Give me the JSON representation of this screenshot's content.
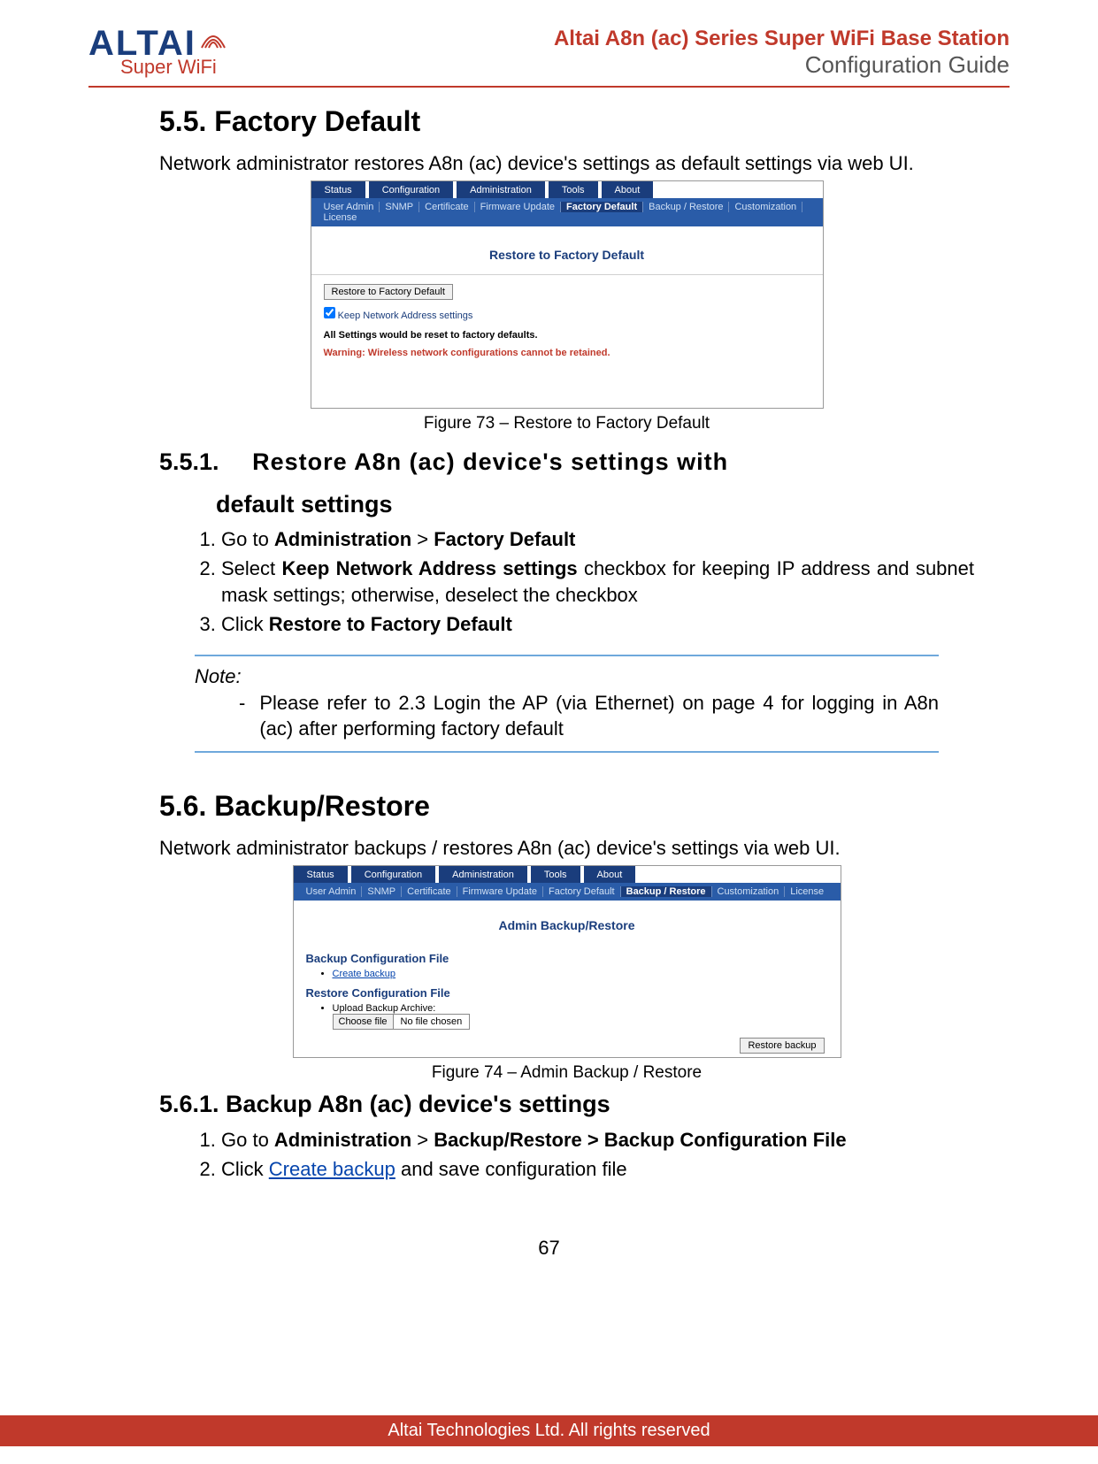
{
  "header": {
    "logo_main": "ALTAI",
    "logo_sub": "Super WiFi",
    "title_line1": "Altai A8n (ac) Series Super WiFi Base Station",
    "title_line2": "Configuration Guide"
  },
  "section55": {
    "heading": "5.5.  Factory Default",
    "intro": "Network administrator restores A8n (ac) device's settings as default settings via web UI."
  },
  "fig73": {
    "caption": "Figure 73 – Restore to Factory Default",
    "main_tabs": [
      "Status",
      "Configuration",
      "Administration",
      "Tools",
      "About"
    ],
    "sub_tabs": [
      "User Admin",
      "SNMP",
      "Certificate",
      "Firmware Update",
      "Factory Default",
      "Backup / Restore",
      "Customization",
      "License"
    ],
    "active_sub": "Factory Default",
    "panel_title": "Restore to Factory Default",
    "button": "Restore to Factory Default",
    "checkbox_label": "Keep Network Address settings",
    "reset_note": "All Settings would be reset to factory defaults.",
    "warning": "Warning: Wireless network configurations cannot be retained."
  },
  "section551": {
    "heading_num": "5.5.1.",
    "heading_text1": "Restore A8n (ac) device's settings with",
    "heading_text2": "default settings",
    "step1_a": "Go to ",
    "step1_b": "Administration",
    "step1_c": " > ",
    "step1_d": "Factory Default",
    "step2_a": "Select ",
    "step2_b": "Keep Network Address settings",
    "step2_c": " checkbox for keeping IP address and subnet mask settings; otherwise, deselect the checkbox",
    "step3_a": "Click ",
    "step3_b": "Restore to Factory Default",
    "note_label": "Note:",
    "note_text": "Please refer to 2.3 Login the AP (via Ethernet) on page 4 for logging in A8n (ac) after performing factory default"
  },
  "section56": {
    "heading": "5.6.  Backup/Restore",
    "intro": "Network administrator backups / restores A8n (ac) device's settings via web UI."
  },
  "fig74": {
    "caption": "Figure 74 – Admin Backup / Restore",
    "main_tabs": [
      "Status",
      "Configuration",
      "Administration",
      "Tools",
      "About"
    ],
    "sub_tabs": [
      "User Admin",
      "SNMP",
      "Certificate",
      "Firmware Update",
      "Factory Default",
      "Backup / Restore",
      "Customization",
      "License"
    ],
    "active_sub": "Backup / Restore",
    "panel_title": "Admin Backup/Restore",
    "backup_section": "Backup Configuration File",
    "backup_link": "Create backup",
    "restore_section": "Restore Configuration File",
    "upload_label": "Upload Backup Archive:",
    "choose_file": "Choose file",
    "no_file": "No file chosen",
    "restore_button": "Restore backup"
  },
  "section561": {
    "heading": "5.6.1.    Backup A8n (ac) device's settings",
    "step1_a": "Go to ",
    "step1_b": "Administration",
    "step1_c": " > ",
    "step1_d": "Backup/Restore > Backup Configuration File",
    "step2_a": "Click ",
    "step2_b": "Create backup",
    "step2_c": " and save configuration file"
  },
  "footer": {
    "page_number": "67",
    "copyright": "Altai Technologies Ltd. All rights reserved"
  }
}
